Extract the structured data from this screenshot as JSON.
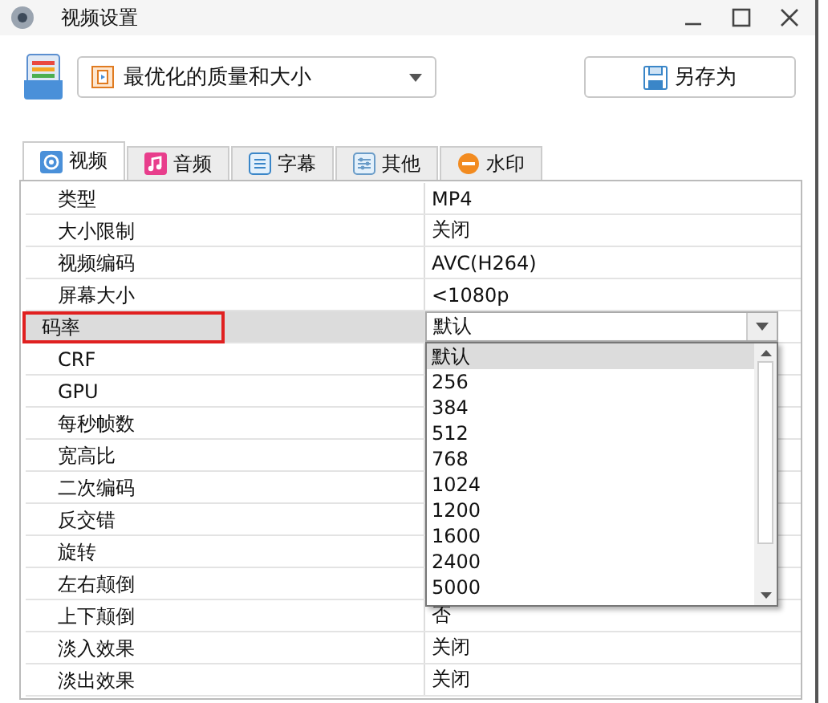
{
  "window": {
    "title": "视频设置"
  },
  "preset": {
    "value": "最优化的质量和大小"
  },
  "save_as_button": {
    "label": "另存为"
  },
  "tabs": [
    {
      "label": "视频",
      "selected": true
    },
    {
      "label": "音频",
      "selected": false
    },
    {
      "label": "字幕",
      "selected": false
    },
    {
      "label": "其他",
      "selected": false
    },
    {
      "label": "水印",
      "selected": false
    }
  ],
  "properties": [
    {
      "name": "类型",
      "value": "MP4",
      "selected": false
    },
    {
      "name": "大小限制",
      "value": "关闭",
      "selected": false
    },
    {
      "name": "视频编码",
      "value": "AVC(H264)",
      "selected": false
    },
    {
      "name": "屏幕大小",
      "value": "<1080p",
      "selected": false
    },
    {
      "name": "码率",
      "value": "默认",
      "selected": true,
      "outlined": true,
      "expanded": true,
      "options": [
        {
          "label": "默认",
          "selected": true
        },
        {
          "label": "256",
          "selected": false
        },
        {
          "label": "384",
          "selected": false
        },
        {
          "label": "512",
          "selected": false
        },
        {
          "label": "768",
          "selected": false
        },
        {
          "label": "1024",
          "selected": false
        },
        {
          "label": "1200",
          "selected": false
        },
        {
          "label": "1600",
          "selected": false
        },
        {
          "label": "2400",
          "selected": false
        },
        {
          "label": "5000",
          "selected": false
        }
      ]
    },
    {
      "name": "CRF",
      "selected": false
    },
    {
      "name": "GPU",
      "selected": false
    },
    {
      "name": "每秒帧数",
      "selected": false
    },
    {
      "name": "宽高比",
      "selected": false
    },
    {
      "name": "二次编码",
      "selected": false
    },
    {
      "name": "反交错",
      "selected": false
    },
    {
      "name": "旋转",
      "selected": false
    },
    {
      "name": "左右颠倒",
      "selected": false
    },
    {
      "name": "上下颠倒",
      "value": "否",
      "selected": false
    },
    {
      "name": "淡入效果",
      "value": "关闭",
      "selected": false
    },
    {
      "name": "淡出效果",
      "value": "关闭",
      "selected": false
    }
  ]
}
